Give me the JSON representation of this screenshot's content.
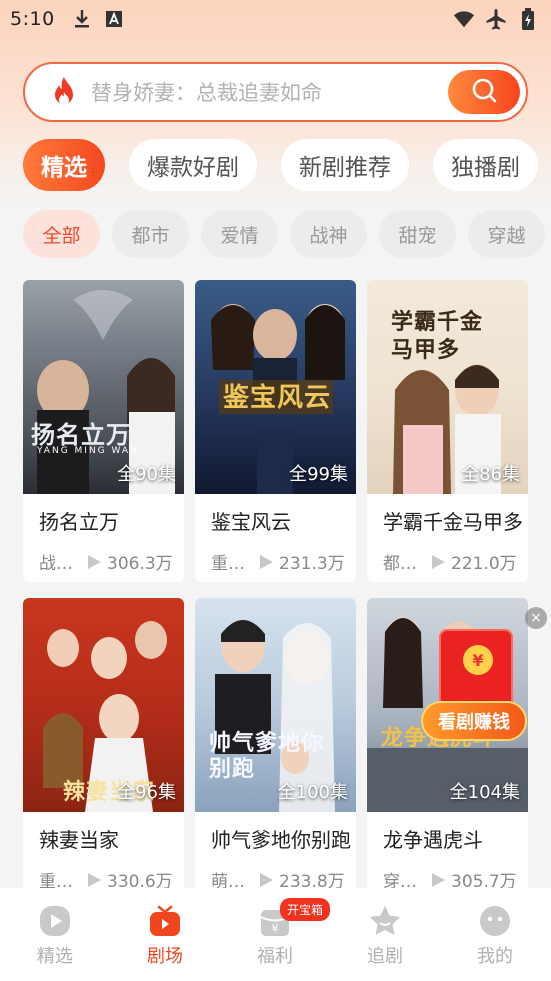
{
  "status_bar": {
    "time": "5:10"
  },
  "search": {
    "placeholder": "替身娇妻：总裁追妻如命"
  },
  "main_tabs": [
    "精选",
    "爆款好剧",
    "新剧推荐",
    "独播剧"
  ],
  "categories": [
    "全部",
    "都市",
    "爱情",
    "战神",
    "甜宠",
    "穿越"
  ],
  "dramas": [
    {
      "title": "扬名立万",
      "episodes": "全90集",
      "genre": "战…",
      "views": "306.3万",
      "poster_text": "扬名立万",
      "poster_subtext": "YANG MING WAN"
    },
    {
      "title": "鉴宝风云",
      "episodes": "全99集",
      "genre": "重…",
      "views": "231.3万",
      "poster_text": "鉴宝风云"
    },
    {
      "title": "学霸千金马甲多",
      "episodes": "全86集",
      "genre": "都…",
      "views": "221.0万",
      "poster_text": "学霸千金马甲多"
    },
    {
      "title": "辣妻当家",
      "episodes": "全96集",
      "genre": "重…",
      "views": "330.6万",
      "poster_text": "辣妻当家"
    },
    {
      "title": "帅气爹地你别跑",
      "episodes": "全100集",
      "genre": "萌…",
      "views": "233.8万",
      "poster_text": "帅气爹地你别跑"
    },
    {
      "title": "龙争遇虎斗",
      "episodes": "全104集",
      "genre": "穿…",
      "views": "305.7万",
      "poster_text": "龙争遇虎斗"
    }
  ],
  "red_packet": {
    "label": "看剧赚钱",
    "coin": "¥"
  },
  "bottom_nav": [
    {
      "label": "精选",
      "icon": "play-circle-icon"
    },
    {
      "label": "剧场",
      "icon": "tv-icon"
    },
    {
      "label": "福利",
      "icon": "wallet-icon",
      "badge": "开宝箱"
    },
    {
      "label": "追剧",
      "icon": "star-icon"
    },
    {
      "label": "我的",
      "icon": "smile-icon"
    }
  ],
  "colors": {
    "accent": "#f0461f",
    "accent_light": "#ff7a3a"
  }
}
